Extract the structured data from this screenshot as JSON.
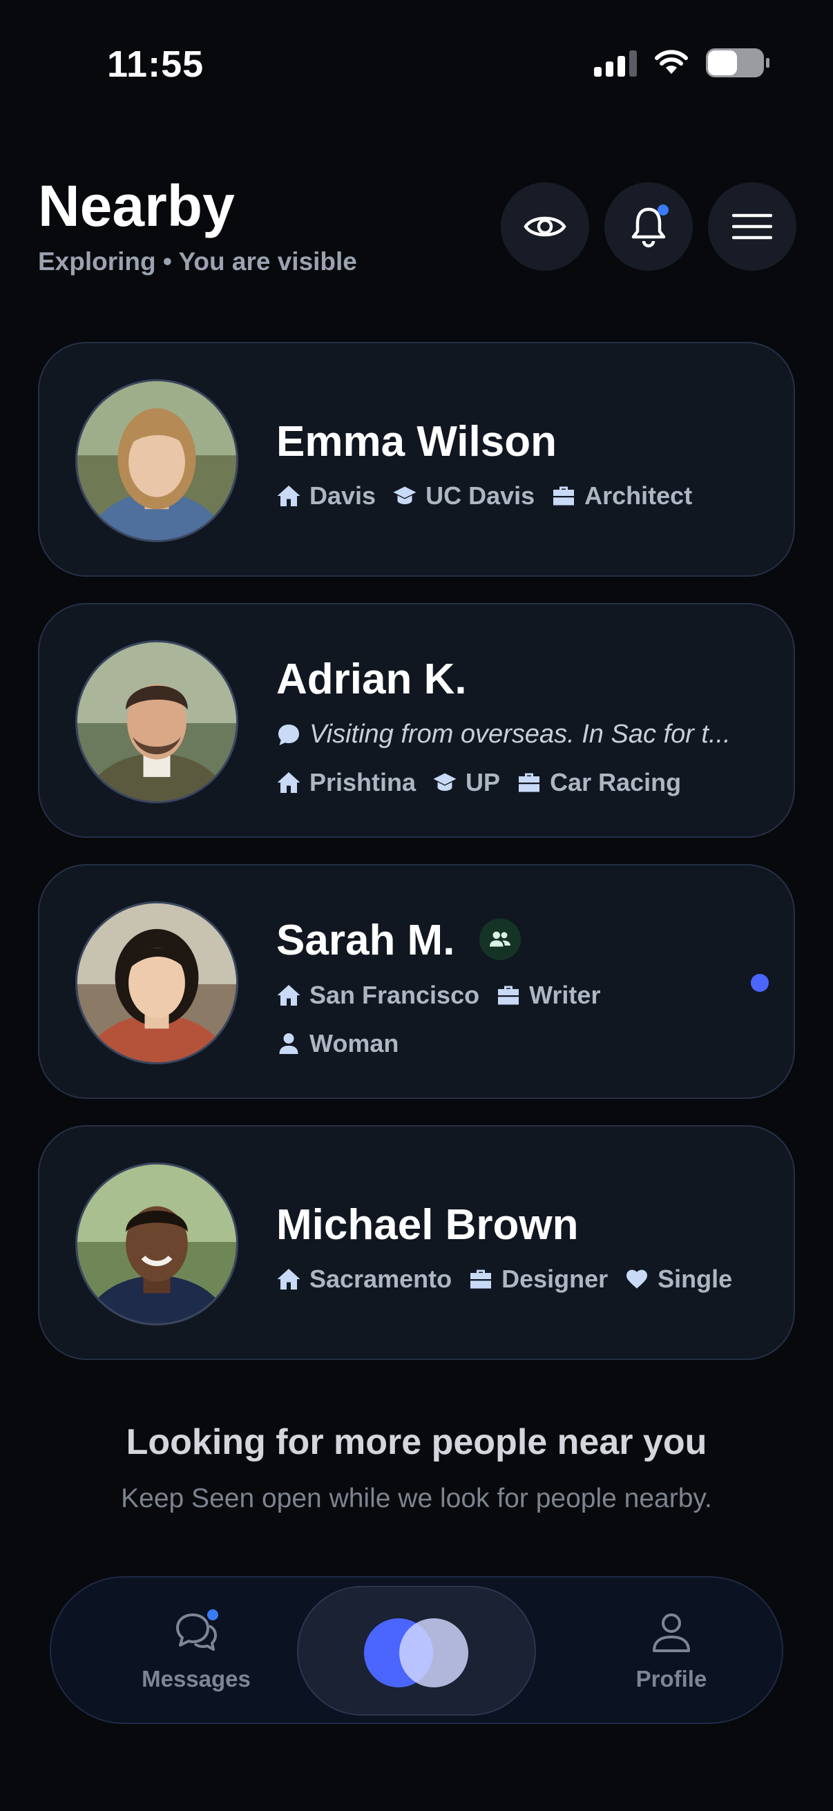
{
  "status_bar": {
    "time": "11:55"
  },
  "header": {
    "title": "Nearby",
    "subtitle": "Exploring • You are visible",
    "buttons": [
      {
        "icon": "eye-icon"
      },
      {
        "icon": "bell-icon",
        "badge": true
      },
      {
        "icon": "menu-icon"
      }
    ]
  },
  "people": [
    {
      "name": "Emma Wilson",
      "tags": [
        {
          "icon": "home-icon",
          "label": "Davis"
        },
        {
          "icon": "graduation-cap-icon",
          "label": "UC Davis"
        },
        {
          "icon": "briefcase-icon",
          "label": "Architect"
        }
      ]
    },
    {
      "name": "Adrian K.",
      "bio": "Visiting from overseas. In Sac for t...",
      "tags": [
        {
          "icon": "home-icon",
          "label": "Prishtina"
        },
        {
          "icon": "graduation-cap-icon",
          "label": "UP"
        },
        {
          "icon": "briefcase-icon",
          "label": "Car Racing"
        }
      ]
    },
    {
      "name": "Sarah M.",
      "has_group_badge": true,
      "online": true,
      "tags": [
        {
          "icon": "home-icon",
          "label": "San Francisco"
        },
        {
          "icon": "briefcase-icon",
          "label": "Writer"
        }
      ],
      "tags2": [
        {
          "icon": "person-icon",
          "label": "Woman"
        }
      ]
    },
    {
      "name": "Michael Brown",
      "tags": [
        {
          "icon": "home-icon",
          "label": "Sacramento"
        },
        {
          "icon": "briefcase-icon",
          "label": "Designer"
        },
        {
          "icon": "heart-icon",
          "label": "Single"
        }
      ]
    }
  ],
  "empty_state": {
    "title": "Looking for more people near you",
    "subtitle": "Keep Seen open while we look for people nearby."
  },
  "tabbar": {
    "messages_label": "Messages",
    "profile_label": "Profile"
  },
  "colors": {
    "background": "#07090d",
    "card": "#111721",
    "accent": "#3a7bf6",
    "center_primary": "#4a66ff"
  }
}
